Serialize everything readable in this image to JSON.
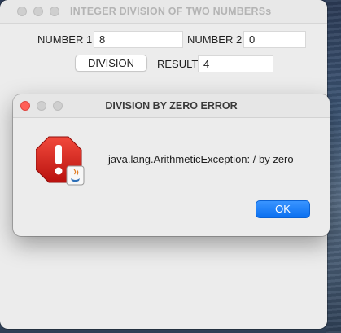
{
  "main_window": {
    "title": "INTEGER DIVISION OF TWO NUMBERSs",
    "number1_label": "NUMBER 1",
    "number1_value": "8",
    "number2_label": "NUMBER 2",
    "number2_value": "0",
    "division_button": "DIVISION",
    "result_label": "RESULT",
    "result_value": "4"
  },
  "dialog": {
    "title": "DIVISION BY ZERO ERROR",
    "message": "java.lang.ArithmeticException: / by zero",
    "ok_button": "OK",
    "icon": "error-stop-icon"
  },
  "colors": {
    "accent": "#0a6ff0",
    "error_red": "#d9201c",
    "close_red": "#ff5f57"
  }
}
